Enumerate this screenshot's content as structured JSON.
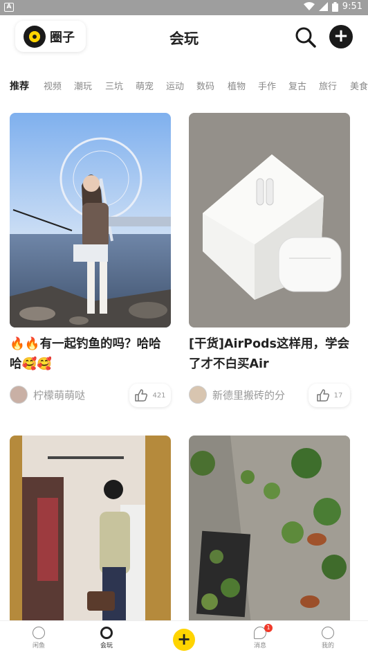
{
  "status_bar": {
    "time": "9:51",
    "battery": "83"
  },
  "header": {
    "circle_label": "圈子",
    "title": "会玩"
  },
  "tabs": [
    "推荐",
    "视频",
    "潮玩",
    "三坑",
    "萌宠",
    "运动",
    "数码",
    "植物",
    "手作",
    "复古",
    "旅行",
    "美食"
  ],
  "cards": [
    {
      "title": "🔥🔥有一起钓鱼的吗？哈哈哈🥰🥰",
      "author": "柠檬萌萌哒",
      "likes": "421"
    },
    {
      "title": "[干货]AirPods这样用，学会了才不白买Air",
      "author": "新德里搬砖的分",
      "likes": "17"
    },
    {
      "title": "",
      "author": "",
      "likes": ""
    },
    {
      "title": "",
      "author": "",
      "likes": ""
    }
  ],
  "tabbar": {
    "items": [
      {
        "label": "闲鱼"
      },
      {
        "label": "会玩"
      },
      {
        "label": "消息",
        "badge": "1"
      },
      {
        "label": "我的"
      }
    ]
  },
  "colors": {
    "accent": "#ffd400",
    "badge": "#f03a2a"
  },
  "icons": [
    "search-icon",
    "add-icon",
    "like-icon",
    "home-icon",
    "play-icon",
    "message-icon",
    "profile-icon"
  ]
}
